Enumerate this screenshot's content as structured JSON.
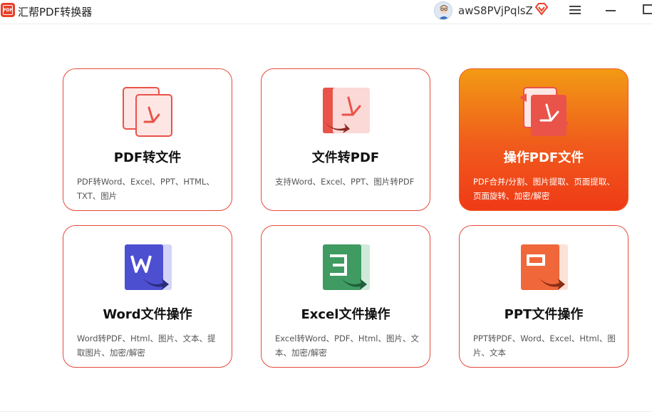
{
  "app": {
    "logo_text": "PDF",
    "title": "汇帮PDF转换器"
  },
  "user": {
    "name": "awS8PVjPqlsZ",
    "avatar_icon": "user-avatar",
    "vip_icon": "vip-diamond-icon"
  },
  "window_controls": {
    "menu_icon": "hamburger-menu-icon",
    "minimize_icon": "minimize-icon",
    "maximize_icon": "maximize-icon"
  },
  "cards": [
    {
      "title": "PDF转文件",
      "desc": "PDF转Word、Excel、PPT、HTML、TXT、图片",
      "icon": "pdf-to-file-icon"
    },
    {
      "title": "文件转PDF",
      "desc": "支持Word、Excel、PPT、图片转PDF",
      "icon": "file-to-pdf-icon"
    },
    {
      "title": "操作PDF文件",
      "desc": "PDF合并/分割、图片提取、页面提取、页面旋转、加密/解密",
      "icon": "operate-pdf-icon",
      "active": true
    },
    {
      "title": "Word文件操作",
      "desc": "Word转PDF、Html、图片、文本、提取图片、加密/解密",
      "icon": "word-icon"
    },
    {
      "title": "Excel文件操作",
      "desc": "Excel转Word、PDF、Html、图片、文本、加密/解密",
      "icon": "excel-icon"
    },
    {
      "title": "PPT文件操作",
      "desc": "PPT转PDF、Word、Excel、Html、图片、文本",
      "icon": "ppt-icon"
    }
  ],
  "colors": {
    "accent": "#e64b3c",
    "active_gradient_top": "#f29a14",
    "active_gradient_bottom": "#ef3a17",
    "word_blue": "#4d4fd1",
    "excel_green": "#3f9b62",
    "ppt_orange": "#f0673a"
  }
}
